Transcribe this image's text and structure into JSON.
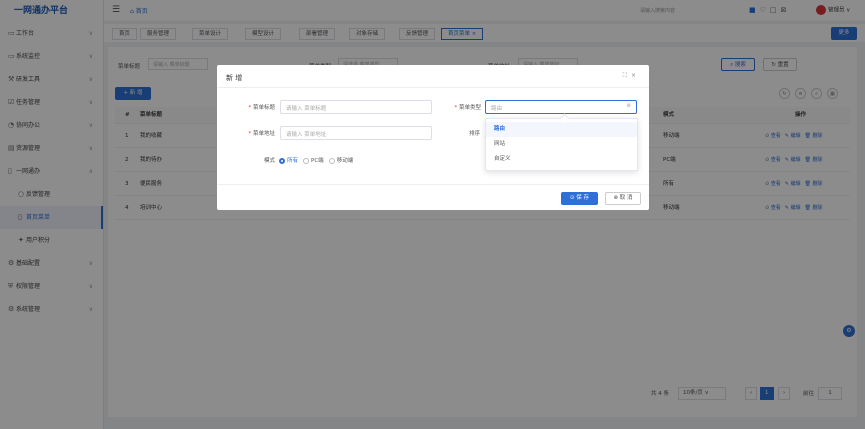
{
  "app": {
    "title": "一网通办平台"
  },
  "sidebar": {
    "items": [
      {
        "label": "工作台",
        "icon": "monitor-icon",
        "chevron": "∨"
      },
      {
        "label": "系统监控",
        "icon": "monitor-icon",
        "chevron": "∨"
      },
      {
        "label": "研发工具",
        "icon": "tools-icon",
        "chevron": "∨"
      },
      {
        "label": "任务管理",
        "icon": "task-icon",
        "chevron": "∨"
      },
      {
        "label": "协同办公",
        "icon": "collab-icon",
        "chevron": "∨"
      },
      {
        "label": "资源管理",
        "icon": "resource-icon",
        "chevron": "∨"
      },
      {
        "label": "一网通办",
        "icon": "file-icon",
        "chevron": "∧"
      },
      {
        "label": "反馈管理",
        "icon": "circle-icon",
        "sub": true
      },
      {
        "label": "首页菜单",
        "icon": "file-icon",
        "sub": true,
        "active": true
      },
      {
        "label": "用户积分",
        "icon": "star-icon",
        "sub": true
      },
      {
        "label": "基础配置",
        "icon": "config-icon",
        "chevron": "∨"
      },
      {
        "label": "权限管理",
        "icon": "lock-icon",
        "chevron": "∨"
      },
      {
        "label": "系统管理",
        "icon": "gear-icon",
        "chevron": "∨"
      }
    ]
  },
  "header": {
    "breadcrumb": "首页",
    "search_hint": "请输入搜索内容",
    "user_name": "管理员"
  },
  "tabs": [
    {
      "label": "首页"
    },
    {
      "label": "服务管理"
    },
    {
      "label": "菜单设计"
    },
    {
      "label": "模型设计"
    },
    {
      "label": "部署管理"
    },
    {
      "label": "对象存储"
    },
    {
      "label": "反馈管理"
    },
    {
      "label": "首页菜单 ×",
      "active": true
    }
  ],
  "more_label": "更多",
  "filters": {
    "title_label": "菜单标题",
    "title_placeholder": "请输入 菜单标题",
    "menu_type_label": "菜单类型",
    "menu_type_placeholder": "请选择 菜单类型",
    "menu_addr_label": "菜单地址",
    "menu_addr_placeholder": "请输入 菜单地址",
    "search_label": "搜索",
    "reset_label": "重置"
  },
  "new_label": "新 增",
  "table": {
    "headers": [
      "#",
      "菜单标题",
      "模式",
      "操作"
    ],
    "rows": [
      {
        "no": "1",
        "title": "我的收藏",
        "mode": "移动端"
      },
      {
        "no": "2",
        "title": "我的待办",
        "mode": "PC端"
      },
      {
        "no": "3",
        "title": "便民服务",
        "mode": "所有"
      },
      {
        "no": "4",
        "title": "培训中心",
        "mode": "移动端"
      }
    ],
    "op_view": "查看",
    "op_edit": "编辑",
    "op_delete": "删除"
  },
  "pager": {
    "total": "共 4 条",
    "page_size": "10条/页",
    "current": "1",
    "goto_label": "前往",
    "goto_value": "1"
  },
  "dialog": {
    "title": "新 增",
    "menu_title_label": "菜单标题",
    "menu_title_placeholder": "请输入 菜单标题",
    "menu_type_label": "菜单类型",
    "menu_type_value": "路由",
    "menu_addr_label": "菜单地址",
    "menu_addr_placeholder": "请输入 菜单地址",
    "sort_label": "排序",
    "mode_label": "模式",
    "mode_options": [
      "所有",
      "PC端",
      "移动端"
    ],
    "save_label": "保 存",
    "cancel_label": "取 消"
  },
  "dropdown": {
    "options": [
      "路由",
      "网站",
      "自定义"
    ],
    "selected": 0
  },
  "colors": {
    "accent": "#2f6fd6",
    "brand": "#1f5bb8",
    "danger": "#d9363e"
  }
}
